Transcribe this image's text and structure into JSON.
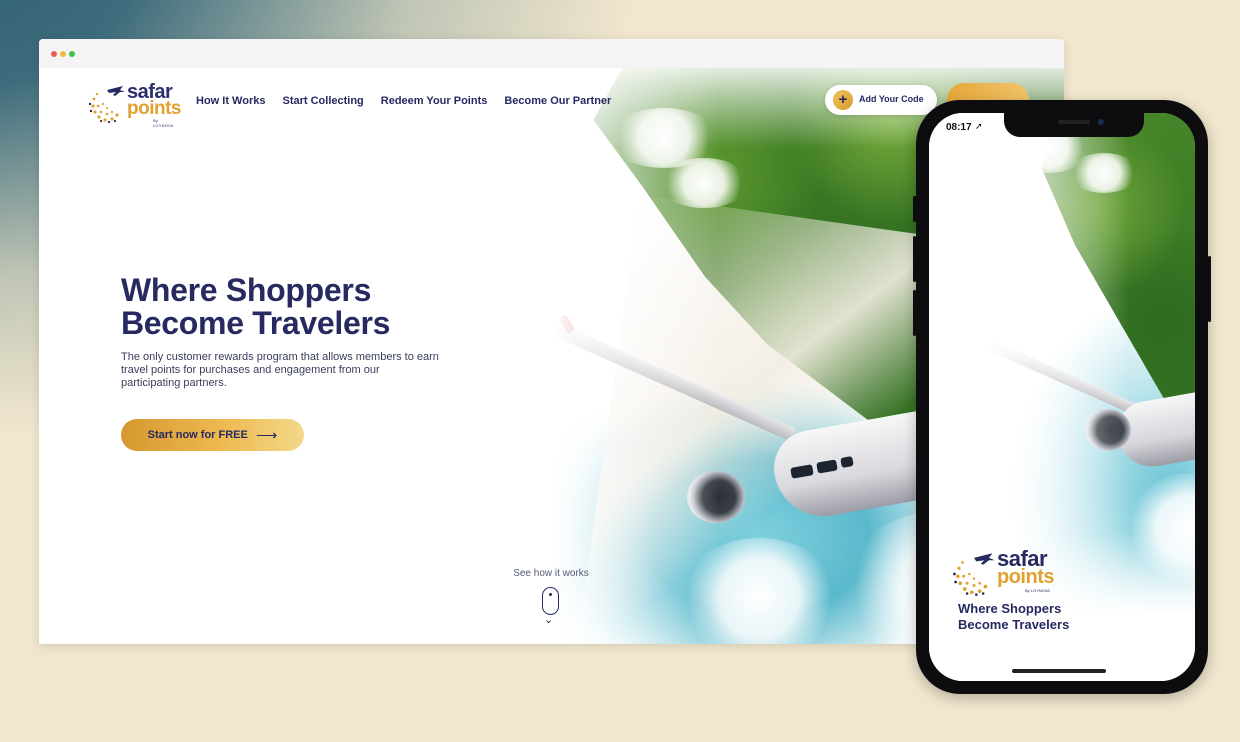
{
  "brand": {
    "word1": "safar",
    "word2": "points",
    "sub": "By LOYNOVA",
    "navy": "#262a60",
    "gold": "#e0a131"
  },
  "nav": {
    "links": [
      "How It Works",
      "Start Collecting",
      "Redeem Your Points",
      "Become Our Partner"
    ],
    "add_code_label": "Add Your Code",
    "add_code_icon": "plus-icon"
  },
  "hero": {
    "title_line1": "Where Shoppers",
    "title_line2": "Become Travelers",
    "description": "The only customer rewards program that allows members to earn travel points for purchases and engagement from our participating partners.",
    "cta_label": "Start now for FREE",
    "cta_icon": "arrow-right-icon"
  },
  "scroll_hint": {
    "label": "See how it works",
    "icon": "mouse-scroll-icon"
  },
  "phone": {
    "time": "08:17",
    "title_line1": "Where Shoppers",
    "title_line2": "Become Travelers"
  }
}
